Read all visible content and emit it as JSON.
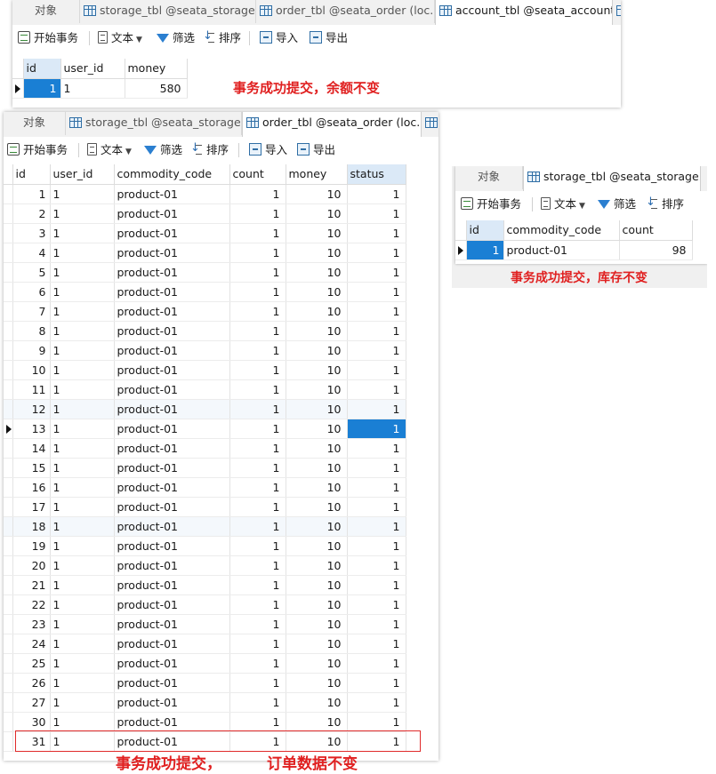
{
  "colors": {
    "accent": "#1a7fd4",
    "annotation": "#e02020"
  },
  "toolbar": {
    "begin_txn": "开始事务",
    "text": "文本",
    "filter": "筛选",
    "sort": "排序",
    "import": "导入",
    "export": "导出"
  },
  "panel_account": {
    "tabs": [
      "对象",
      "storage_tbl @seata_storage...",
      "order_tbl @seata_order (loc...",
      "account_tbl @seata_account..."
    ],
    "columns": [
      "id",
      "user_id",
      "money"
    ],
    "rows": [
      [
        "1",
        "1",
        "580"
      ]
    ],
    "annotation": "事务成功提交，余额不变"
  },
  "panel_order": {
    "tabs": [
      "对象",
      "storage_tbl @seata_storage...",
      "order_tbl @seata_order (loc..."
    ],
    "columns": [
      "id",
      "user_id",
      "commodity_code",
      "count",
      "money",
      "status"
    ],
    "rows": [
      [
        "1",
        "1",
        "product-01",
        "1",
        "10",
        "1"
      ],
      [
        "2",
        "1",
        "product-01",
        "1",
        "10",
        "1"
      ],
      [
        "3",
        "1",
        "product-01",
        "1",
        "10",
        "1"
      ],
      [
        "4",
        "1",
        "product-01",
        "1",
        "10",
        "1"
      ],
      [
        "5",
        "1",
        "product-01",
        "1",
        "10",
        "1"
      ],
      [
        "6",
        "1",
        "product-01",
        "1",
        "10",
        "1"
      ],
      [
        "7",
        "1",
        "product-01",
        "1",
        "10",
        "1"
      ],
      [
        "8",
        "1",
        "product-01",
        "1",
        "10",
        "1"
      ],
      [
        "9",
        "1",
        "product-01",
        "1",
        "10",
        "1"
      ],
      [
        "10",
        "1",
        "product-01",
        "1",
        "10",
        "1"
      ],
      [
        "11",
        "1",
        "product-01",
        "1",
        "10",
        "1"
      ],
      [
        "12",
        "1",
        "product-01",
        "1",
        "10",
        "1"
      ],
      [
        "13",
        "1",
        "product-01",
        "1",
        "10",
        "1"
      ],
      [
        "14",
        "1",
        "product-01",
        "1",
        "10",
        "1"
      ],
      [
        "15",
        "1",
        "product-01",
        "1",
        "10",
        "1"
      ],
      [
        "16",
        "1",
        "product-01",
        "1",
        "10",
        "1"
      ],
      [
        "17",
        "1",
        "product-01",
        "1",
        "10",
        "1"
      ],
      [
        "18",
        "1",
        "product-01",
        "1",
        "10",
        "1"
      ],
      [
        "19",
        "1",
        "product-01",
        "1",
        "10",
        "1"
      ],
      [
        "20",
        "1",
        "product-01",
        "1",
        "10",
        "1"
      ],
      [
        "21",
        "1",
        "product-01",
        "1",
        "10",
        "1"
      ],
      [
        "22",
        "1",
        "product-01",
        "1",
        "10",
        "1"
      ],
      [
        "23",
        "1",
        "product-01",
        "1",
        "10",
        "1"
      ],
      [
        "24",
        "1",
        "product-01",
        "1",
        "10",
        "1"
      ],
      [
        "25",
        "1",
        "product-01",
        "1",
        "10",
        "1"
      ],
      [
        "26",
        "1",
        "product-01",
        "1",
        "10",
        "1"
      ],
      [
        "27",
        "1",
        "product-01",
        "1",
        "10",
        "1"
      ],
      [
        "30",
        "1",
        "product-01",
        "1",
        "10",
        "1"
      ],
      [
        "31",
        "1",
        "product-01",
        "1",
        "10",
        "1"
      ]
    ],
    "annotation_left": "事务成功提交，",
    "annotation_right": "订单数据不变"
  },
  "panel_storage": {
    "tabs": [
      "对象",
      "storage_tbl @seata_storage..."
    ],
    "columns": [
      "id",
      "commodity_code",
      "count"
    ],
    "rows": [
      [
        "1",
        "product-01",
        "98"
      ]
    ],
    "annotation": "事务成功提交，库存不变"
  }
}
